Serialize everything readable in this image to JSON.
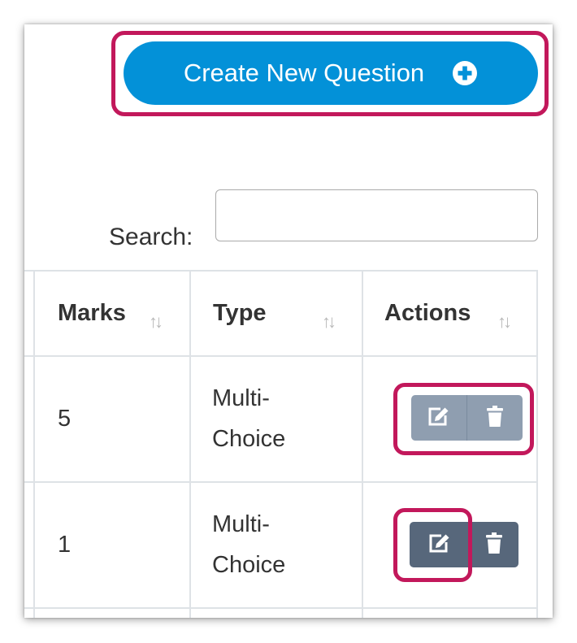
{
  "create_button": {
    "label": "Create New Question",
    "icon": "plus-circle-icon",
    "color": "#0391d8"
  },
  "search": {
    "label": "Search:",
    "value": "",
    "placeholder": ""
  },
  "table": {
    "columns": [
      {
        "label": "Marks",
        "sort_icon": "sort-icon"
      },
      {
        "label": "Type",
        "sort_icon": "sort-icon"
      },
      {
        "label": "Actions",
        "sort_icon": "sort-icon"
      }
    ],
    "rows": [
      {
        "marks": "5",
        "type_line1": "Multi-",
        "type_line2": "Choice",
        "actions": [
          "edit-icon",
          "trash-icon"
        ]
      },
      {
        "marks": "1",
        "type_line1": "Multi-",
        "type_line2": "Choice",
        "actions": [
          "edit-icon",
          "trash-icon"
        ]
      }
    ]
  },
  "highlight_color": "#c2185b"
}
